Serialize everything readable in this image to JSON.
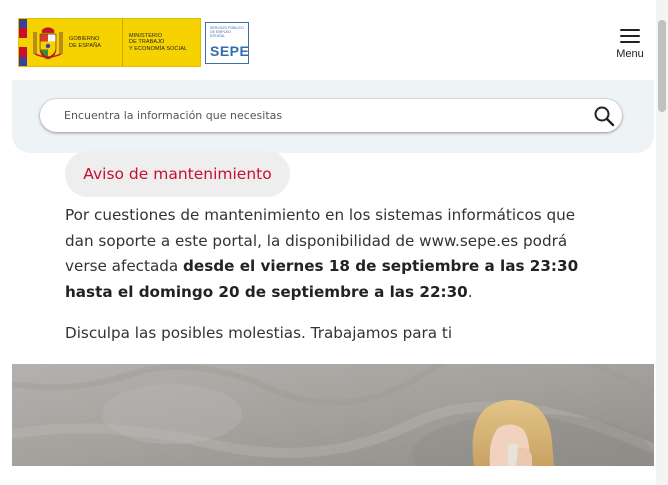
{
  "header": {
    "gov_logo": {
      "left_text": "Gobierno\nde España",
      "right_text": "Ministerio\nde Trabajo\ny Economía Social",
      "colors": {
        "yellow": "#f6d300",
        "red": "#c8102e"
      }
    },
    "sepe_logo": {
      "small_text": "Servicio Público\nde Empleo Estatal",
      "name": "SEPE",
      "color": "#2f6db0"
    },
    "menu": {
      "label": "Menu",
      "icon": "hamburger-icon"
    }
  },
  "search": {
    "placeholder": "Encuentra la información que necesitas",
    "icon": "search-icon"
  },
  "notice": {
    "title": "Aviso de mantenimiento",
    "title_color": "#c8102e",
    "body_start": "Por cuestiones de mantenimiento en los sistemas informáticos que dan soporte a este portal, la disponibilidad de www.sepe.es podrá verse afectada ",
    "body_bold": "desde el viernes 18 de septiembre a las 23:30 hasta el domingo 20 de septiembre a las 22:30",
    "body_end": ".",
    "closing": "Disculpa las posibles molestias. Trabajamos para ti"
  },
  "hero": {
    "image": "woman-on-phone-photo"
  }
}
